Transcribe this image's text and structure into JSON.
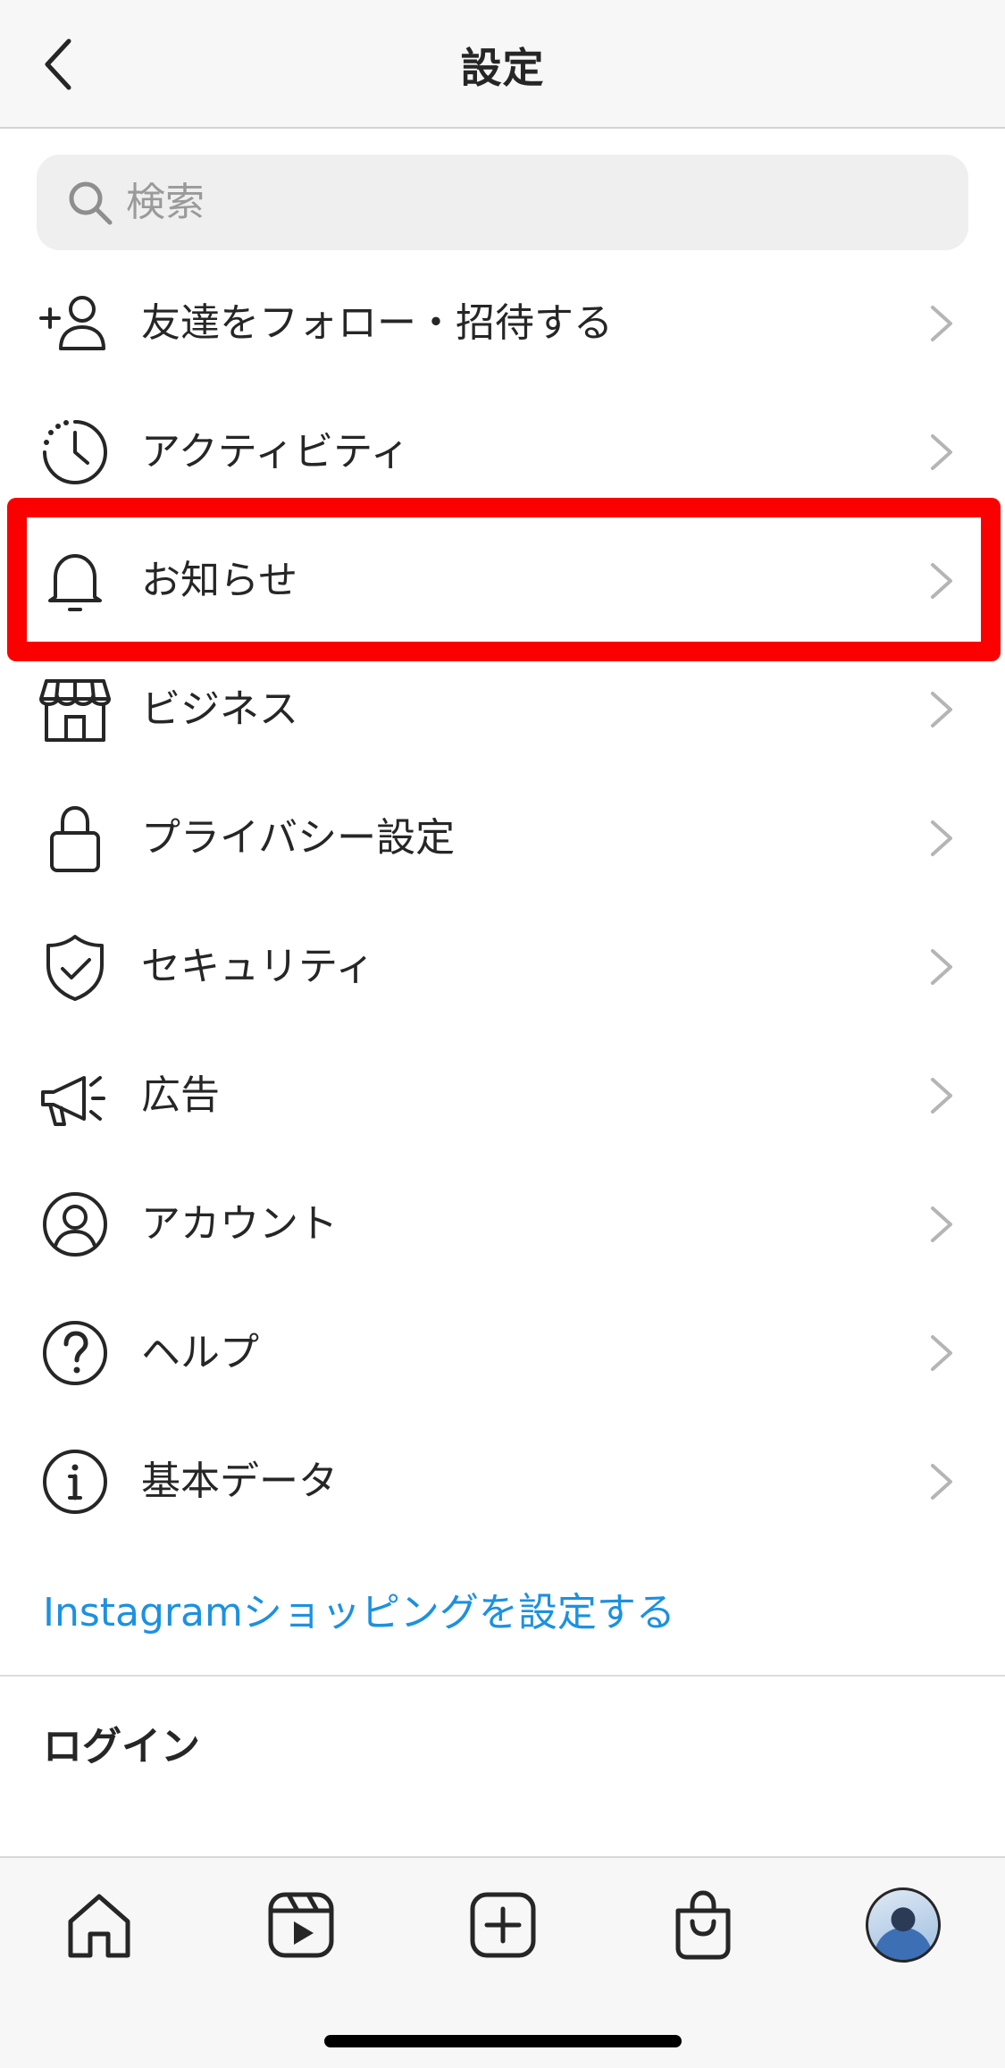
{
  "header": {
    "title": "設定"
  },
  "search": {
    "placeholder": "検索",
    "value": ""
  },
  "menu": {
    "items": [
      {
        "label": "友達をフォロー・招待する",
        "icon": "add-person-icon"
      },
      {
        "label": "アクティビティ",
        "icon": "activity-clock-icon"
      },
      {
        "label": "お知らせ",
        "icon": "bell-icon"
      },
      {
        "label": "ビジネス",
        "icon": "shop-icon"
      },
      {
        "label": "プライバシー設定",
        "icon": "lock-icon"
      },
      {
        "label": "セキュリティ",
        "icon": "shield-check-icon"
      },
      {
        "label": "広告",
        "icon": "megaphone-icon"
      },
      {
        "label": "アカウント",
        "icon": "account-circle-icon"
      },
      {
        "label": "ヘルプ",
        "icon": "help-circle-icon"
      },
      {
        "label": "基本データ",
        "icon": "info-circle-icon"
      }
    ]
  },
  "shopping_link": "Instagramショッピングを設定する",
  "login_section": {
    "title": "ログイン"
  },
  "tabbar": {
    "items": [
      "home-icon",
      "reels-icon",
      "create-post-icon",
      "shop-bag-icon",
      "profile-avatar"
    ]
  },
  "colors": {
    "highlight": "#fa0000",
    "link": "#1c91e0",
    "text": "#262626",
    "chevron": "#b5b5b5",
    "search_bg": "#efefef"
  }
}
